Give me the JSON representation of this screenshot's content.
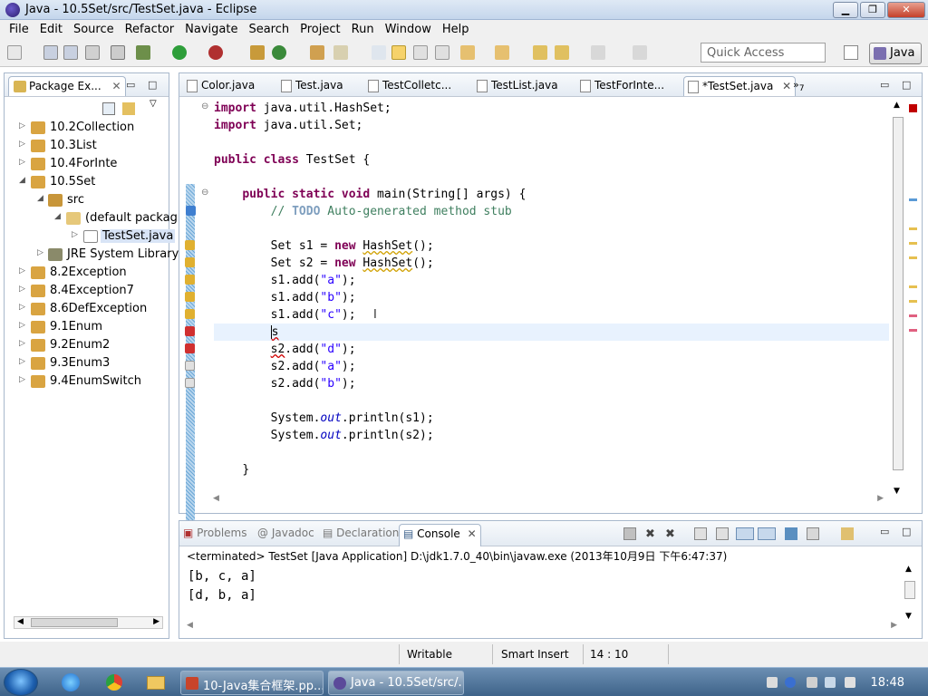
{
  "window": {
    "title": "Java - 10.5Set/src/TestSet.java - Eclipse"
  },
  "menu": [
    "File",
    "Edit",
    "Source",
    "Refactor",
    "Navigate",
    "Search",
    "Project",
    "Run",
    "Window",
    "Help"
  ],
  "toolbar": {
    "quick_access_placeholder": "Quick Access",
    "perspective": "Java"
  },
  "package_explorer": {
    "tab_label": "Package Ex...",
    "tree": [
      {
        "label": "10.2Collection",
        "icon": "project-icon",
        "expanded": false
      },
      {
        "label": "10.3List",
        "icon": "project-icon",
        "expanded": false
      },
      {
        "label": "10.4ForInte",
        "icon": "project-icon",
        "expanded": false
      },
      {
        "label": "10.5Set",
        "icon": "project-icon",
        "expanded": true
      },
      {
        "label": "src",
        "icon": "source-folder-icon",
        "expanded": true
      },
      {
        "label": "(default packag",
        "icon": "package-icon",
        "expanded": true
      },
      {
        "label": "TestSet.java",
        "icon": "java-file-icon",
        "expanded": false,
        "selected": true
      },
      {
        "label": "JRE System Library",
        "icon": "library-icon",
        "expanded": false
      },
      {
        "label": "8.2Exception",
        "icon": "project-icon",
        "expanded": false
      },
      {
        "label": "8.4Exception7",
        "icon": "project-icon",
        "expanded": false
      },
      {
        "label": "8.6DefException",
        "icon": "project-icon",
        "expanded": false
      },
      {
        "label": "9.1Enum",
        "icon": "project-icon",
        "expanded": false
      },
      {
        "label": "9.2Enum2",
        "icon": "project-icon",
        "expanded": false
      },
      {
        "label": "9.3Enum3",
        "icon": "project-icon",
        "expanded": false
      },
      {
        "label": "9.4EnumSwitch",
        "icon": "project-icon",
        "expanded": false
      }
    ]
  },
  "editor": {
    "tabs": [
      {
        "label": "Color.java"
      },
      {
        "label": "Test.java"
      },
      {
        "label": "TestColletc..."
      },
      {
        "label": "TestList.java"
      },
      {
        "label": "TestForInte..."
      },
      {
        "label": "*TestSet.java",
        "active": true
      }
    ],
    "overflow_count": "7",
    "code": {
      "l1": "java.util.HashSet;",
      "l2": "java.util.Set;",
      "l4": "TestSet {",
      "l6": "main(String[] args) {",
      "l7": "Auto-generated method stub",
      "l9a": "Set s1 = ",
      "l9b": "HashSet",
      "l9c": "();",
      "l10a": "Set s2 = ",
      "l10b": "HashSet",
      "l10c": "();",
      "add_call": ".add(",
      "s1": "s1",
      "s2": "s2",
      "lit_a": "\"a\"",
      "lit_b": "\"b\"",
      "lit_c": "\"c\"",
      "lit_d": "\"d\"",
      "close": ");",
      "partial": "s",
      "println1": "System.",
      "out": "out",
      "println2a": ".println(s1);",
      "println2b": ".println(s2);",
      "brace": "}"
    }
  },
  "console": {
    "tabs": [
      "Problems",
      "Javadoc",
      "Declaration",
      "Console"
    ],
    "status": "<terminated> TestSet [Java Application] D:\\jdk1.7.0_40\\bin\\javaw.exe (2013年10月9日 下午6:47:37)",
    "output": [
      "[b, c, a]",
      "[d, b, a]"
    ]
  },
  "statusbar": {
    "mode": "Writable",
    "insert": "Smart Insert",
    "position": "14 : 10"
  },
  "taskbar": {
    "tasks": [
      {
        "label": "10-Java集合框架.pp..."
      },
      {
        "label": "Java - 10.5Set/src/..."
      }
    ],
    "clock": "18:48"
  },
  "colors": {
    "keyword": "#7f0055",
    "comment": "#3f7f5f",
    "string": "#2a00ff",
    "field": "#0000c0"
  }
}
